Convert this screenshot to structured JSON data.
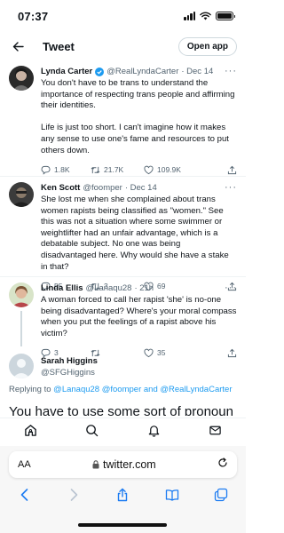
{
  "status_bar": {
    "time": "07:37"
  },
  "header": {
    "title": "Tweet",
    "open_app_label": "Open app"
  },
  "tweets": [
    {
      "name": "Lynda Carter",
      "handle": "@RealLyndaCarter",
      "date": "· Dec 14",
      "paragraphs": [
        "You don't have to be trans to understand the importance of respecting trans people and affirming their identities.",
        "Life is just too short. I can't imagine how it makes any sense to use one's fame and resources to put others down."
      ],
      "replies": "1.8K",
      "retweets": "21.7K",
      "likes": "109.9K"
    },
    {
      "name": "Ken Scott",
      "handle": "@foomper",
      "date": "· Dec 14",
      "paragraphs": [
        "She lost me when she complained about trans women rapists being classified as \"women.\"  See this was not a situation where some swimmer or weightlifter had an unfair advantage, which is a debatable subject. No one was being disadvantaged here. Why would she have a stake in that?"
      ],
      "replies": "55",
      "retweets": "3",
      "likes": "69"
    },
    {
      "name": "Linda Ellis",
      "handle": "@Lanaqu28",
      "date": "· 21h",
      "paragraphs": [
        "A woman forced to call her rapist 'she' is no-one being disadvantaged? Where's your moral compass when you put the feelings of a rapist above his victim?"
      ],
      "replies": "3",
      "retweets": "",
      "likes": "35"
    }
  ],
  "composer": {
    "name": "Sarah Higgins",
    "handle": "@SFGHiggins",
    "replying_prefix": "Replying to",
    "replying_to": [
      "@Lanaqu28",
      "@foomper",
      "and",
      "@RealLyndaCarter"
    ],
    "partial_text": "You have to use some sort of pronoun"
  },
  "safari": {
    "aa_label": "AA",
    "url": "twitter.com"
  },
  "icons": [
    "back-arrow-icon",
    "more-icon",
    "reply-icon",
    "retweet-icon",
    "like-icon",
    "share-icon",
    "home-icon",
    "search-icon",
    "notifications-icon",
    "messages-icon",
    "lock-icon",
    "reload-icon",
    "safari-back-icon",
    "safari-forward-icon",
    "safari-share-icon",
    "bookmarks-icon",
    "tabs-icon"
  ],
  "colors": {
    "link": "#1d9bf0",
    "muted": "#536471",
    "text": "#0f1419"
  }
}
